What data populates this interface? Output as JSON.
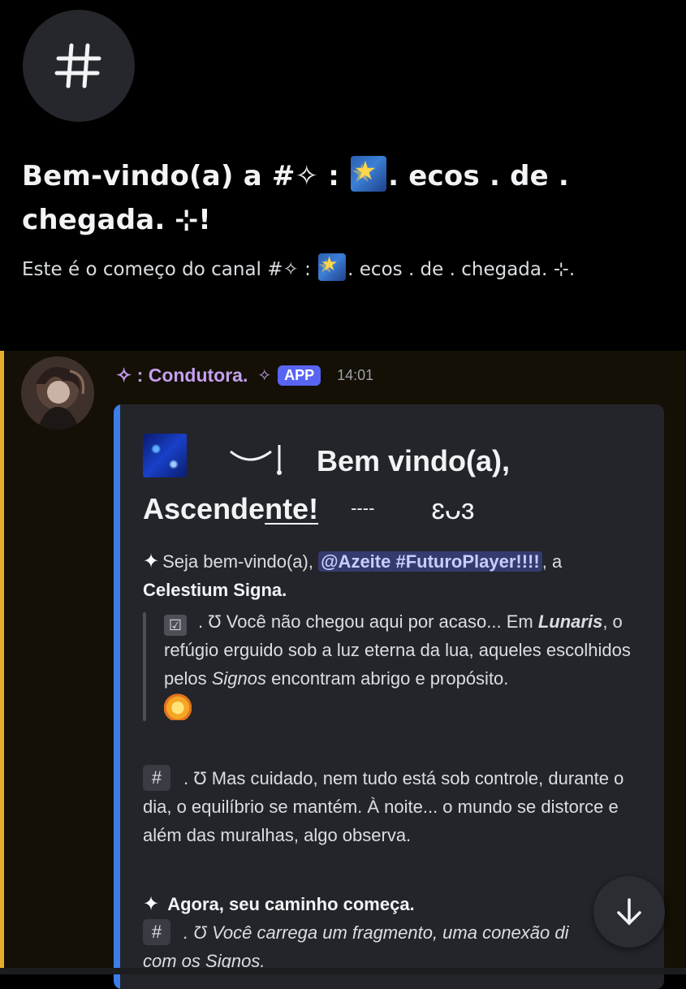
{
  "channel_header": {
    "icon": "hash-icon",
    "title": "Bem-vindo(a) a #✧ : 🌠.  ecos . de . chegada. ⊹!",
    "title_line1_prefix": "Bem-vindo(a) a #✧ :",
    "title_line1_suffix": ".  ecos . de .",
    "title_line2": "chegada.  ⊹!",
    "subtitle_prefix": "Este é o começo do canal #✧ :",
    "subtitle_suffix": ".  ecos . de . chegada. ⊹."
  },
  "message": {
    "author": "✧ : Condutora.",
    "author_sparkle": "✧",
    "badge": "APP",
    "timestamp": "14:01",
    "highlight_color": "#e6ad2a"
  },
  "embed": {
    "accent_color": "#3b7de9",
    "title_part1": "Bem vindo(a),",
    "title_part2_plain": "Ascende",
    "title_part2_underlined": "nte!",
    "title_part3": "----",
    "title_glyph": "ɛᴗɜ",
    "welcome_spark": "✦",
    "welcome_text": "Seja bem-vindo(a),",
    "mention": "@Azeite #FuturoPlayer!!!!",
    "welcome_after": ", a",
    "server_name": "Celestium Signa.",
    "quote_icon": "ballot-box-icon",
    "quote_text_1": ". Ʊ Você não chegou aqui por acaso... Em",
    "quote_lunaris": "Lunaris",
    "quote_text_2": ", o refúgio erguido sob a luz eterna da lua, aqueles escolhidos pelos",
    "quote_signos": "Signos",
    "quote_text_3": "encontram abrigo e propósito.",
    "para2_hash": "#",
    "para2_text": ". Ʊ Mas cuidado, nem tudo está sob controle, durante o dia, o equilíbrio se mantém. À noite... o mundo se distorce e além das muralhas, algo observa.",
    "section_spark": "✦",
    "section_title": "Agora, seu caminho começa.",
    "para3_hash": "#",
    "para3_text": ". Ʊ Você carrega um fragmento, uma conexão di",
    "para3_text_2": "com os",
    "para3_signos": "Signos."
  },
  "controls": {
    "scroll_icon": "arrow-down-icon"
  }
}
